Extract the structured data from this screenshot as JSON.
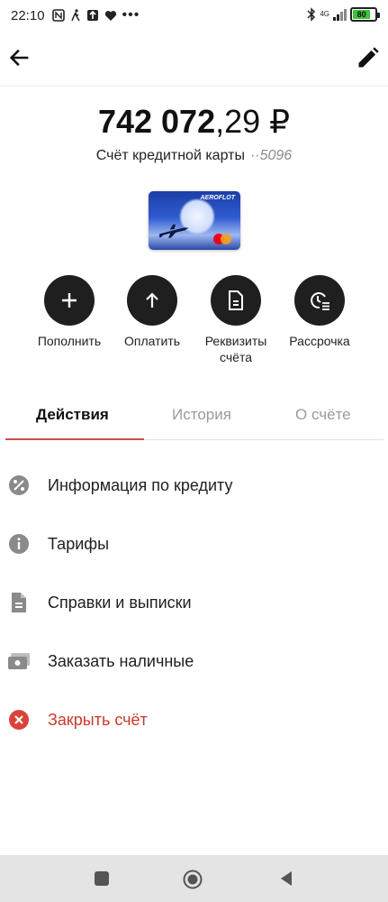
{
  "status_bar": {
    "time": "22:10",
    "network": "4G",
    "battery": "80"
  },
  "app_bar": {
    "back_icon": "arrow-left-icon",
    "edit_icon": "pencil-icon"
  },
  "balance": {
    "integer": "742 072",
    "fraction": ",29 ₽"
  },
  "account": {
    "label": "Счёт кредитной карты",
    "mask": "··5096"
  },
  "card": {
    "brand": "AEROFLOT"
  },
  "actions": [
    {
      "label": "Пополнить",
      "icon": "plus-icon"
    },
    {
      "label": "Оплатить",
      "icon": "arrow-up-icon"
    },
    {
      "label": "Реквизиты\nсчёта",
      "icon": "document-icon"
    },
    {
      "label": "Рассрочка",
      "icon": "clock-list-icon"
    }
  ],
  "tabs": [
    {
      "label": "Действия",
      "active": true
    },
    {
      "label": "История",
      "active": false
    },
    {
      "label": "О счёте",
      "active": false
    }
  ],
  "menu": [
    {
      "label": "Информация по кредиту",
      "icon": "percent-icon"
    },
    {
      "label": "Тарифы",
      "icon": "info-icon"
    },
    {
      "label": "Справки и выписки",
      "icon": "document-icon"
    },
    {
      "label": "Заказать наличные",
      "icon": "cash-icon"
    },
    {
      "label": "Закрыть счёт",
      "icon": "close-circle-icon",
      "danger": true
    }
  ],
  "colors": {
    "accent": "#d14b4b",
    "danger": "#c9392c",
    "action_bg": "#1f1f1f",
    "battery": "#3cc23c"
  }
}
